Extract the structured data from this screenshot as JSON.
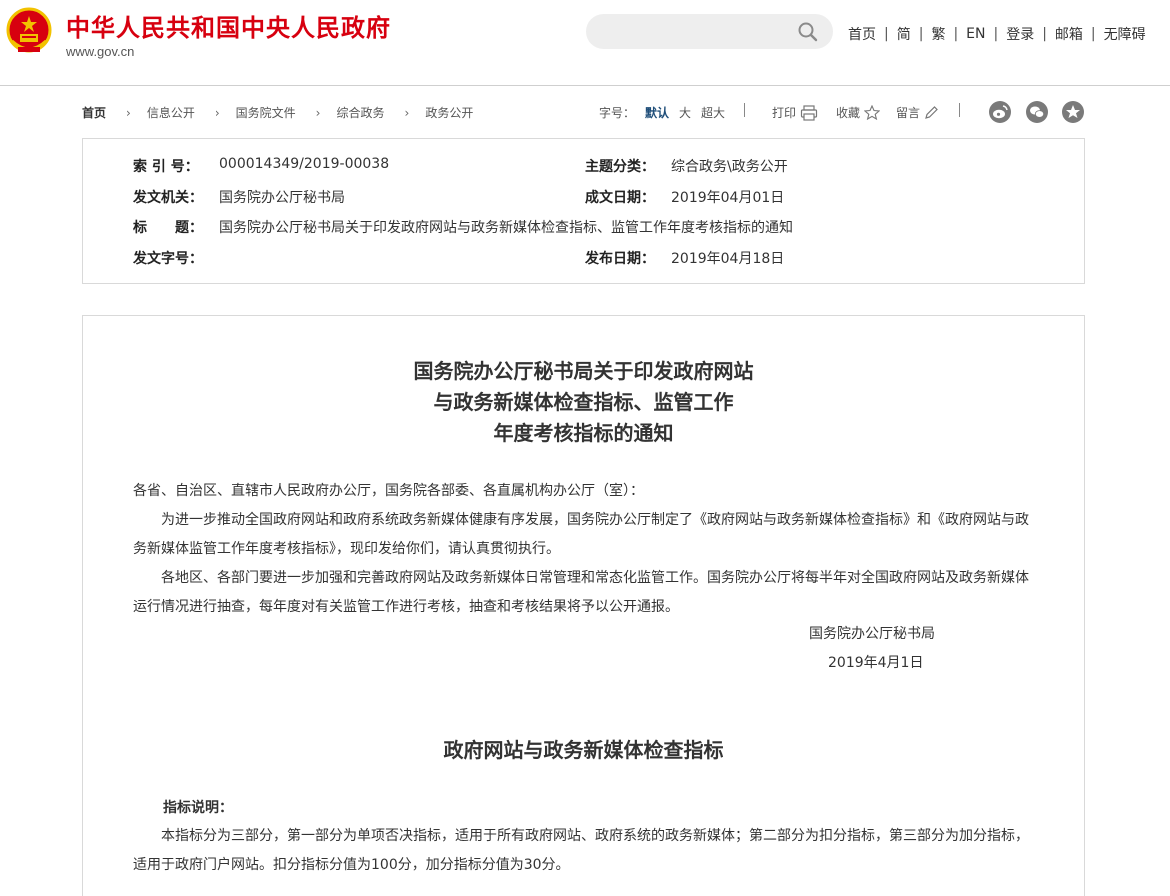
{
  "header": {
    "site_title": "中华人民共和国中央人民政府",
    "site_url": "www.gov.cn",
    "emblem_icon": "national-emblem-icon",
    "search": {
      "placeholder": "",
      "icon": "search-icon"
    },
    "links": [
      "首页",
      "简",
      "繁",
      "EN",
      "登录",
      "邮箱",
      "无障碍"
    ],
    "separator": "|"
  },
  "breadcrumb": {
    "items": [
      "首页",
      "信息公开",
      "国务院文件",
      "综合政务",
      "政务公开"
    ],
    "arrow": "›"
  },
  "tools": {
    "font_size_label": "字号：",
    "font_sizes": [
      "默认",
      "大",
      "超大"
    ],
    "active_font_size": "默认",
    "print_label": "打印",
    "favorite_label": "收藏",
    "comment_label": "留言",
    "share_icons": [
      "weibo-icon",
      "wechat-icon",
      "qzone-icon"
    ]
  },
  "info": {
    "index_label": "索 引 号：",
    "index_value": "000014349/2019-00038",
    "category_label": "主题分类：",
    "category_value": "综合政务\\政务公开",
    "issuer_label": "发文机关：",
    "issuer_value": "国务院办公厅秘书局",
    "created_label": "成文日期：",
    "created_value": "2019年04月01日",
    "title_label": "标　　题：",
    "title_value": "国务院办公厅秘书局关于印发政府网站与政务新媒体检查指标、监管工作年度考核指标的通知",
    "docnum_label": "发文字号：",
    "docnum_value": "",
    "published_label": "发布日期：",
    "published_value": "2019年04月18日"
  },
  "article": {
    "title_lines": [
      "国务院办公厅秘书局关于印发政府网站",
      "与政务新媒体检查指标、监管工作",
      "年度考核指标的通知"
    ],
    "salutation": "各省、自治区、直辖市人民政府办公厅，国务院各部委、各直属机构办公厅（室）：",
    "paragraph_1": "为进一步推动全国政府网站和政府系统政务新媒体健康有序发展，国务院办公厅制定了《政府网站与政务新媒体检查指标》和《政府网站与政务新媒体监管工作年度考核指标》，现印发给你们，请认真贯彻执行。",
    "paragraph_2": "各地区、各部门要进一步加强和完善政府网站及政务新媒体日常管理和常态化监管工作。国务院办公厅将每半年对全国政府网站及政务新媒体运行情况进行抽查，每年度对有关监管工作进行考核，抽查和考核结果将予以公开通报。",
    "signature": "国务院办公厅秘书局",
    "date": "2019年4月1日",
    "section_title": "政府网站与政务新媒体检查指标",
    "note_label": "指标说明：",
    "note_text": "本指标分为三部分，第一部分为单项否决指标，适用于所有政府网站、政府系统的政务新媒体；第二部分为扣分指标，第三部分为加分指标，适用于政府门户网站。扣分指标分值为100分，加分指标分值为30分。"
  },
  "colors": {
    "brand_red": "#d7000f",
    "emblem_gold": "#f2c200",
    "border": "#d9d9d9",
    "search_bg": "#eeeeee",
    "active_blue": "#1f4e79"
  }
}
